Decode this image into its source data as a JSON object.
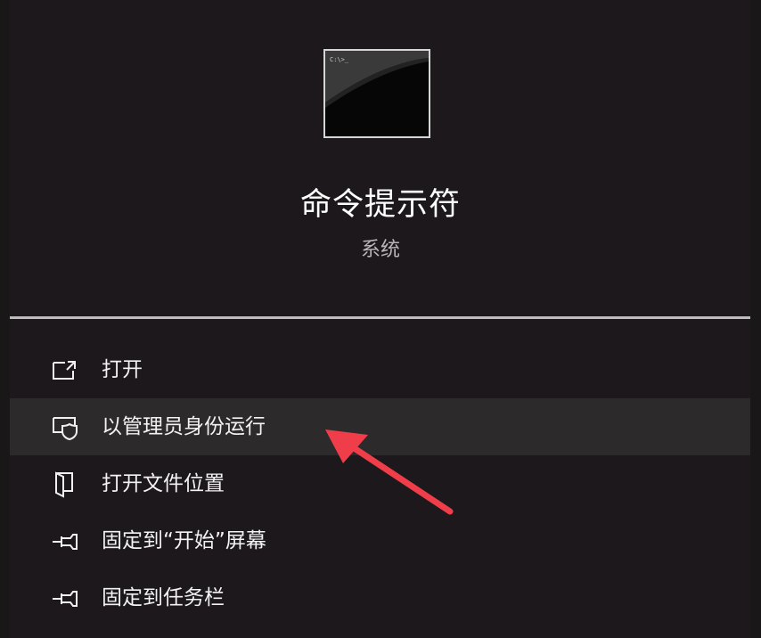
{
  "app": {
    "title": "命令提示符",
    "subtitle": "系统",
    "icon": "command-prompt-icon"
  },
  "menu": {
    "items": [
      {
        "label": "打开",
        "icon": "open-external-icon"
      },
      {
        "label": "以管理员身份运行",
        "icon": "shield-admin-icon",
        "highlighted": true
      },
      {
        "label": "打开文件位置",
        "icon": "file-location-icon"
      },
      {
        "label": "固定到“开始”屏幕",
        "icon": "pin-icon"
      },
      {
        "label": "固定到任务栏",
        "icon": "pin-icon"
      }
    ]
  },
  "annotation": {
    "arrow_color": "#ef3e4a",
    "points_to": "以管理员身份运行"
  },
  "colors": {
    "background": "#1c181b",
    "highlight": "#2c2a2b",
    "divider": "#bdbdbd"
  }
}
